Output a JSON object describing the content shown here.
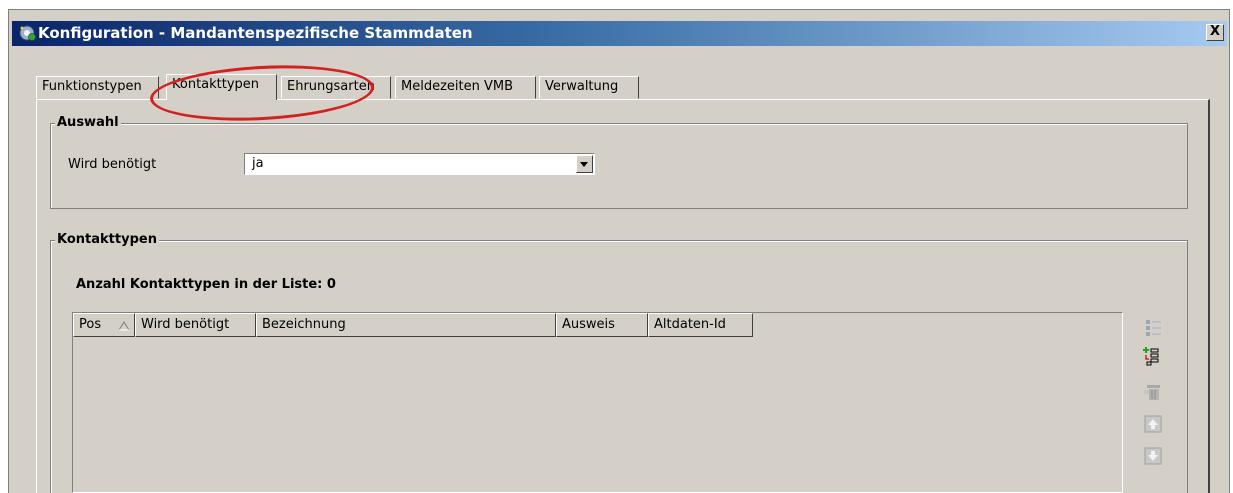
{
  "window": {
    "title": "Konfiguration - Mandantenspezifische Stammdaten",
    "close_label": "X"
  },
  "tabs": [
    {
      "label": "Funktionstypen",
      "active": false
    },
    {
      "label": "Kontakttypen",
      "active": true
    },
    {
      "label": "Ehrungsarten",
      "active": false
    },
    {
      "label": "Meldezeiten VMB",
      "active": false
    },
    {
      "label": "Verwaltung",
      "active": false
    }
  ],
  "auswahl": {
    "legend": "Auswahl",
    "field_label": "Wird benötigt",
    "field_value": "ja"
  },
  "kontakttypen": {
    "legend": "Kontakttypen",
    "count_text": "Anzahl Kontakttypen in der Liste: 0",
    "columns": [
      "Pos",
      "Wird benötigt",
      "Bezeichnung",
      "Ausweis",
      "Altdaten-Id"
    ],
    "rows": []
  },
  "side_toolbar": [
    "columns-icon",
    "add-row-icon",
    "delete-icon",
    "move-up-icon",
    "move-down-icon"
  ],
  "colors": {
    "title_gradient_start": "#0a246a",
    "title_gradient_end": "#a6caf0",
    "dialog_face": "#d4d0c8",
    "annotation_red": "#d52020"
  }
}
